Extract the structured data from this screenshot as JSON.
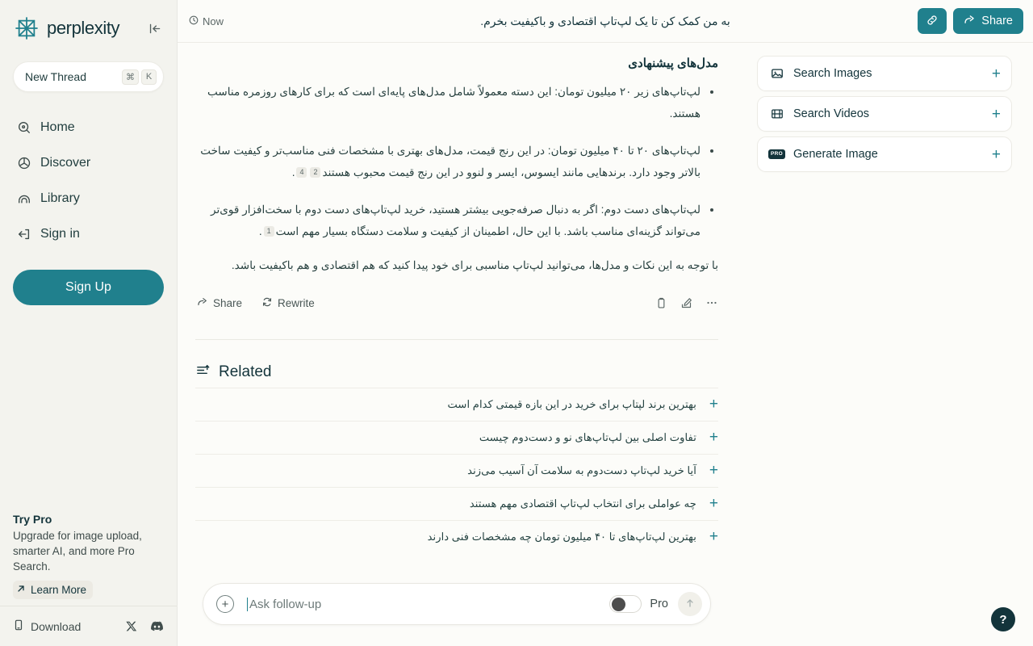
{
  "brand": {
    "name": "perplexity",
    "logo_icon": "perplexity-star-logo",
    "collapse_icon": "collapse-sidebar-icon",
    "accent_color": "#20808d",
    "sidebar_bg": "#f3f3ee",
    "page_bg": "#fcfcf9"
  },
  "sidebar": {
    "new_thread": {
      "label": "New Thread",
      "shortcut_keys": [
        "⌘",
        "K"
      ]
    },
    "items": [
      {
        "label": "Home",
        "icon": "home-search-icon"
      },
      {
        "label": "Discover",
        "icon": "discover-globe-icon"
      },
      {
        "label": "Library",
        "icon": "library-icon"
      },
      {
        "label": "Sign in",
        "icon": "sign-in-icon"
      }
    ],
    "signup_label": "Sign Up",
    "try_pro": {
      "title": "Try Pro",
      "description": "Upgrade for image upload, smarter AI, and more Pro Search.",
      "cta": "Learn More",
      "cta_icon": "arrow-up-right-icon"
    },
    "footer": {
      "download_label": "Download",
      "download_icon": "mobile-device-icon",
      "social": [
        {
          "name": "x-twitter-icon",
          "glyph": "𝕏"
        },
        {
          "name": "discord-icon",
          "glyph": "●"
        }
      ]
    }
  },
  "topbar": {
    "timestamp": "Now",
    "timestamp_icon": "clock-icon",
    "thread_title": "به من کمک کن تا یک لپ‌تاپ اقتصادی و باکیفیت بخرم.",
    "copy_link_icon": "link-chain-icon",
    "share_label": "Share",
    "share_icon": "share-arrow-icon"
  },
  "answer": {
    "heading": "مدل‌های پیشنهادی",
    "bullets": [
      {
        "text": "لپ‌تاپ‌های زیر ۲۰ میلیون تومان: این دسته معمولاً شامل مدل‌های پایه‌ای است که برای کارهای روزمره مناسب هستند.",
        "citations": []
      },
      {
        "text": "لپ‌تاپ‌های ۲۰ تا ۴۰ میلیون تومان: در این رنج قیمت، مدل‌های بهتری با مشخصات فنی مناسب‌تر و کیفیت ساخت بالاتر وجود دارد. برندهایی مانند ایسوس، ایسر و لنوو در این رنج قیمت محبوب هستند",
        "citations": [
          "2",
          "4"
        ],
        "suffix": "."
      },
      {
        "text": "لپ‌تاپ‌های دست دوم: اگر به دنبال صرفه‌جویی بیشتر هستید، خرید لپ‌تاپ‌های دست دوم با سخت‌افزار قوی‌تر می‌تواند گزینه‌ای مناسب باشد. با این حال، اطمینان از کیفیت و سلامت دستگاه بسیار مهم است",
        "citations": [
          "1"
        ],
        "suffix": "."
      }
    ],
    "closing": "با توجه به این نکات و مدل‌ها، می‌توانید لپ‌تاپ مناسبی برای خود پیدا کنید که هم اقتصادی و هم باکیفیت باشد.",
    "actions": {
      "share": {
        "label": "Share",
        "icon": "share-arrow-icon"
      },
      "rewrite": {
        "label": "Rewrite",
        "icon": "rewrite-refresh-icon"
      },
      "copy_icon": "copy-clipboard-icon",
      "edit_icon": "edit-pencil-icon",
      "more_icon": "more-ellipsis-icon"
    }
  },
  "related": {
    "title": "Related",
    "icon": "related-lines-icon",
    "items": [
      {
        "question": "بهترین برند لپتاپ برای خرید در این بازه قیمتی کدام است",
        "add_icon": "plus-icon"
      },
      {
        "question": "تفاوت اصلی بین لپ‌تاپ‌های نو و دست‌دوم چیست",
        "add_icon": "plus-icon"
      },
      {
        "question": "آیا خرید لپ‌تاپ دست‌دوم به سلامت آن آسیب می‌زند",
        "add_icon": "plus-icon"
      },
      {
        "question": "چه عواملی برای انتخاب لپ‌تاپ اقتصادی مهم هستند",
        "add_icon": "plus-icon"
      },
      {
        "question": "بهترین لپ‌تاپ‌های تا ۴۰ میلیون تومان چه مشخصات فنی دارند",
        "add_icon": "plus-icon"
      }
    ]
  },
  "right_rail": {
    "cards": [
      {
        "label": "Search Images",
        "icon": "image-icon",
        "add_icon": "plus-icon",
        "pro": false
      },
      {
        "label": "Search Videos",
        "icon": "video-film-icon",
        "add_icon": "plus-icon",
        "pro": false
      },
      {
        "label": "Generate Image",
        "icon": "pro-badge-icon",
        "add_icon": "plus-icon",
        "pro": true,
        "pro_text": "PRO"
      }
    ]
  },
  "composer": {
    "add_icon": "plus-circle-icon",
    "placeholder": "Ask follow-up",
    "value": "",
    "pro_toggle_label": "Pro",
    "pro_toggle_on": false,
    "submit_icon": "arrow-up-icon"
  },
  "help": {
    "label": "?",
    "icon": "question-mark-icon"
  }
}
